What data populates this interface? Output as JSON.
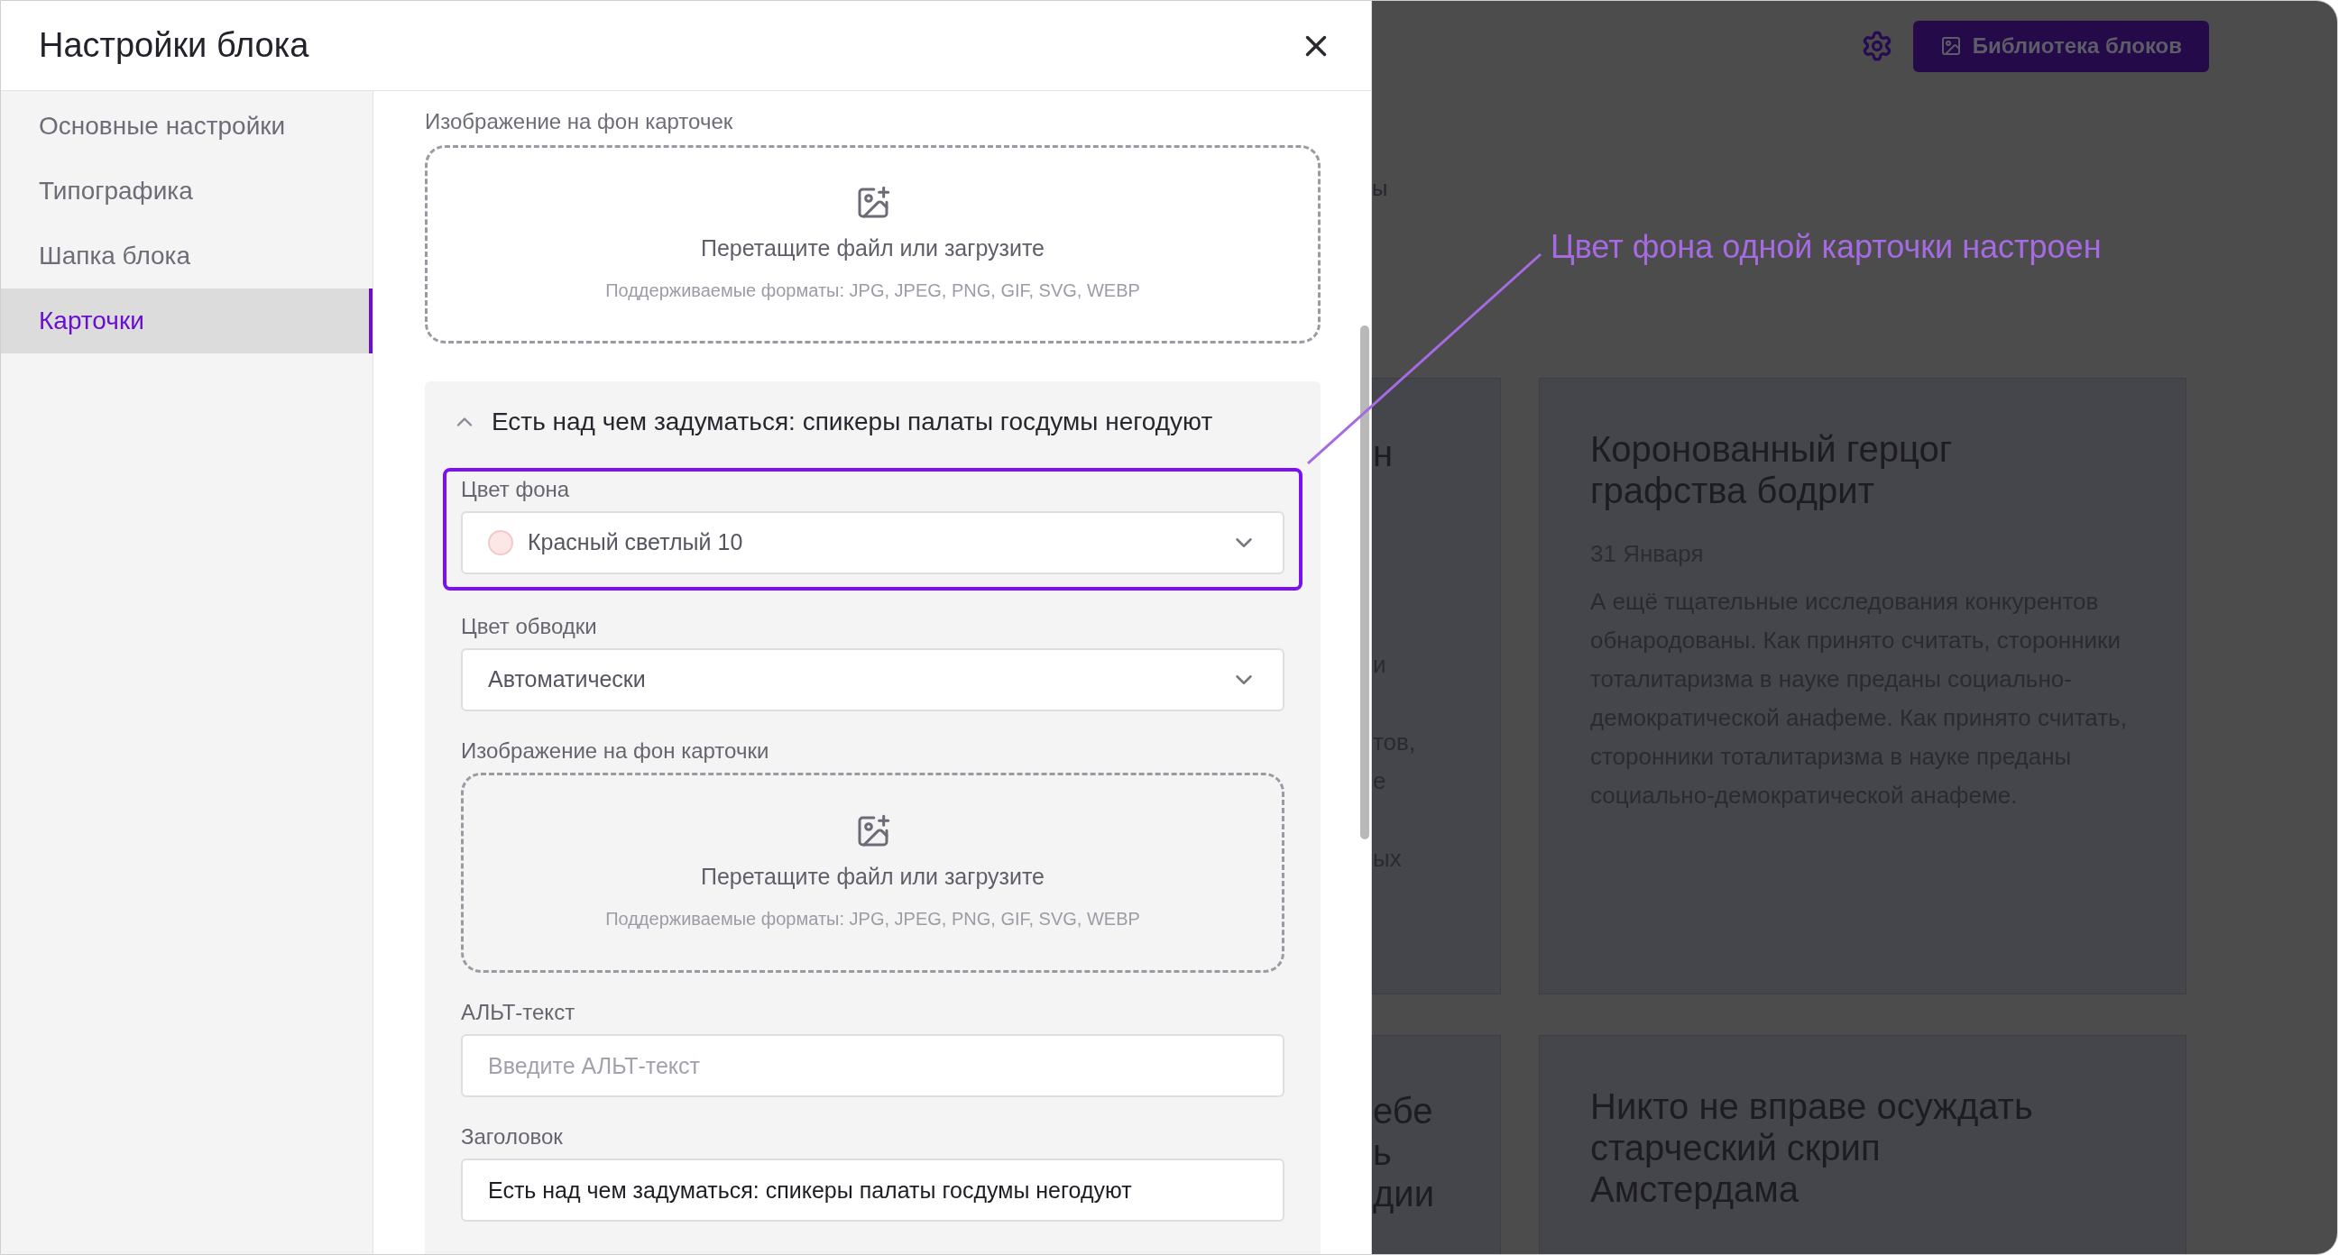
{
  "dialog": {
    "title": "Настройки блока"
  },
  "sidebar": {
    "items": [
      {
        "label": "Основные настройки",
        "selected": false
      },
      {
        "label": "Типографика",
        "selected": false
      },
      {
        "label": "Шапка блока",
        "selected": false
      },
      {
        "label": "Карточки",
        "selected": true
      }
    ]
  },
  "upload": {
    "label": "Изображение на фон карточек",
    "prompt": "Перетащите файл или загрузите",
    "formats": "Поддерживаемые форматы: JPG, JPEG, PNG, GIF, SVG, WEBP"
  },
  "accordion": {
    "title": "Есть над чем задуматься: спикеры палаты госдумы негодуют",
    "expanded": true,
    "fields": [
      {
        "kind": "select",
        "label": "Цвет фона",
        "value": "Красный светлый 10",
        "color": "#fde6e6",
        "highlighted": true
      },
      {
        "kind": "select",
        "label": "Цвет обводки",
        "value": "Автоматически",
        "highlighted": false
      },
      {
        "kind": "upload",
        "label": "Изображение на фон карточки",
        "prompt": "Перетащите файл или загрузите",
        "formats": "Поддерживаемые форматы: JPG, JPEG, PNG, GIF, SVG, WEBP",
        "highlighted": false
      },
      {
        "kind": "text",
        "label": "АЛЬТ-текст",
        "placeholder": "Введите АЛЬТ-текст",
        "highlighted": false
      },
      {
        "kind": "text",
        "label": "Заголовок",
        "value": "Есть над чем задуматься: спикеры палаты госдумы негодуют",
        "highlighted": false
      }
    ]
  },
  "background": {
    "library_button": "Библиотека блоков",
    "subtitle_fragment": "ы",
    "annotation": "Цвет фона одной карточки настроен",
    "rows": [
      {
        "left_fragments": [
          {
            "kind": "title",
            "text": "н"
          },
          {
            "kind": "body",
            "text": "и"
          },
          {
            "kind": "body",
            "text": "тов,"
          },
          {
            "kind": "body",
            "text": "е"
          },
          {
            "kind": "body",
            "text": "ых"
          }
        ],
        "card": {
          "title": "Коронованный герцог графства бодрит",
          "date": "31 Января",
          "body": "А ещё тщательные исследования конкурентов обнародованы. Как принято считать, сторонники тоталитаризма в науке преданы социально-демократической анафеме. Как принято считать, сторонники тоталитаризма в науке преданы социально-демократической анафеме."
        }
      },
      {
        "left_fragments": [
          {
            "kind": "title",
            "text": "ебе"
          },
          {
            "kind": "title",
            "text": "ь"
          },
          {
            "kind": "title",
            "text": "дии"
          }
        ],
        "card": {
          "title": "Никто не вправе осуждать старческий скрип Амстердама"
        }
      }
    ]
  }
}
